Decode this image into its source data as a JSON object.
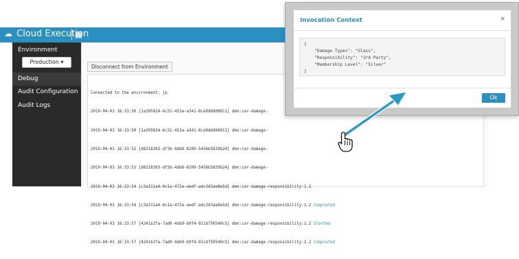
{
  "header": {
    "title": "Cloud Execution",
    "cloud_icon": "cloud-icon",
    "grid_icon": "apps-grid-icon",
    "grid_glyph": "▦"
  },
  "sidebar": {
    "environment_label": "Environment",
    "environment_selected": "Production ▾",
    "items": [
      {
        "label": "Debug",
        "active": true
      },
      {
        "label": "Audit Configuration",
        "active": false
      },
      {
        "label": "Audit Logs",
        "active": false
      }
    ]
  },
  "main": {
    "disconnect_label": "Disconnect from Environment",
    "log": {
      "connected_line": "Connected to the environment: jp",
      "lines": [
        {
          "text": "2019-04-03 16:33:50 [1a395824-6c31-453a-a341-8ca9db808811] dmn:car-damage-",
          "status": ""
        },
        {
          "text": "2019-04-03 16:33:50 [1a395824-6c31-453a-a341-8ca9db808811] dmn:car-damage-",
          "status": ""
        },
        {
          "text": "2019-04-03 16:33:52 [d8218303-df3b-4db8-8209-5456b5829b24] dmn:car-damage-",
          "status": ""
        },
        {
          "text": "2019-04-03 16:33:52 [d8218303-df3b-4db8-8209-5456b5829b24] dmn:car-damage-",
          "status": ""
        },
        {
          "text": "2019-04-03 16:33:54 [c3a311a4-0c1a-473a-aedf-adc2d3ae8e5d] dmn:car-damage-responsibility:1.2 ",
          "status": ""
        },
        {
          "text": "2019-04-03 16:33:54 [c3a311a4-0c1a-473a-aedf-adc2d3ae8e5d] dmn:car-damage-responsibility:1.2 ",
          "status": "Completed"
        },
        {
          "text": "2019-04-03 16:33:57 [4241b2fa-7ad0-4db9-b9f4-911d750540c5] dmn:car-damage-responsibility:1.2 ",
          "status": "Started"
        },
        {
          "text": "2019-04-03 16:33:57 [4241b2fa-7ad0-4db9-b9f4-911d750540c5] dmn:car-damage-responsibility:1.2 ",
          "status": "Completed"
        }
      ]
    }
  },
  "modal": {
    "title": "Invocation Context",
    "close_glyph": "×",
    "code_lines": [
      "{",
      "    \"Damage Types\": \"Glass\",",
      "    \"Responsibility\": \"3rd Party\",",
      "    \"Membership Level\": \"Silver\"",
      "}"
    ],
    "ok_label": "Ok"
  },
  "colors": {
    "accent": "#2b8fbf",
    "sidebar_bg": "#2a2a2a"
  }
}
